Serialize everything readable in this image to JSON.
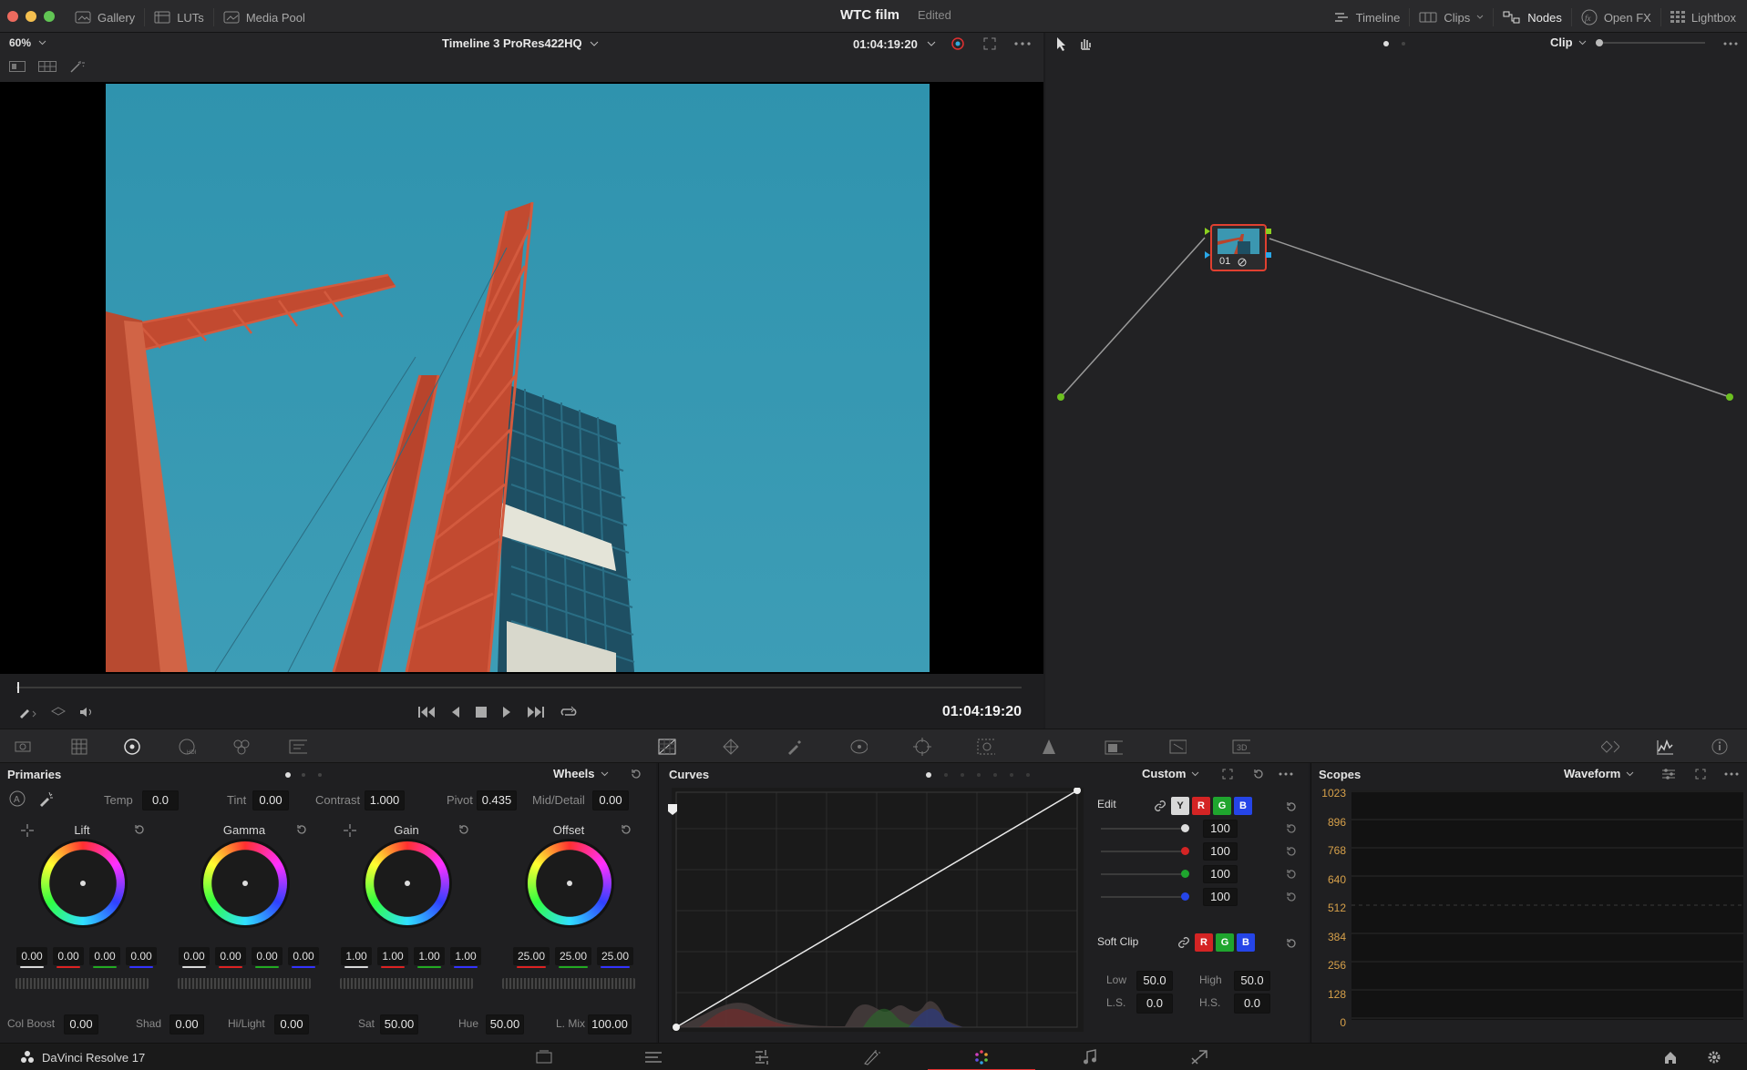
{
  "titlebar": {
    "title": "WTC film",
    "status": "Edited",
    "left": [
      {
        "label": "Gallery",
        "icon": "gallery-icon"
      },
      {
        "label": "LUTs",
        "icon": "luts-icon"
      },
      {
        "label": "Media Pool",
        "icon": "media-pool-icon"
      }
    ],
    "right": [
      {
        "label": "Timeline",
        "icon": "timeline-icon"
      },
      {
        "label": "Clips",
        "icon": "clips-icon"
      },
      {
        "label": "Nodes",
        "icon": "nodes-icon"
      },
      {
        "label": "Open FX",
        "icon": "fx-icon"
      },
      {
        "label": "Lightbox",
        "icon": "lightbox-icon"
      }
    ]
  },
  "viewer": {
    "zoom": "60%",
    "timeline_name": "Timeline 3 ProRes422HQ",
    "timecode": "01:04:19:20",
    "playhead_timecode": "01:04:19:20"
  },
  "nodes": {
    "mode": "Clip",
    "node_label": "01"
  },
  "primaries": {
    "title": "Primaries",
    "mode": "Wheels",
    "temp_label": "Temp",
    "temp": "0.0",
    "tint_label": "Tint",
    "tint": "0.00",
    "contrast_label": "Contrast",
    "contrast": "1.000",
    "pivot_label": "Pivot",
    "pivot": "0.435",
    "middetail_label": "Mid/Detail",
    "middetail": "0.00",
    "wheels": [
      {
        "name": "Lift",
        "values": [
          "0.00",
          "0.00",
          "0.00",
          "0.00"
        ]
      },
      {
        "name": "Gamma",
        "values": [
          "0.00",
          "0.00",
          "0.00",
          "0.00"
        ]
      },
      {
        "name": "Gain",
        "values": [
          "1.00",
          "1.00",
          "1.00",
          "1.00"
        ]
      },
      {
        "name": "Offset",
        "values": [
          "25.00",
          "25.00",
          "25.00"
        ]
      }
    ],
    "colboost_label": "Col Boost",
    "colboost": "0.00",
    "shad_label": "Shad",
    "shad": "0.00",
    "hilight_label": "Hi/Light",
    "hilight": "0.00",
    "sat_label": "Sat",
    "sat": "50.00",
    "hue_label": "Hue",
    "hue": "50.00",
    "lmix_label": "L. Mix",
    "lmix": "100.00"
  },
  "curves": {
    "title": "Curves",
    "mode": "Custom"
  },
  "curve_edit": {
    "edit_label": "Edit",
    "channels": [
      "Y",
      "R",
      "G",
      "B"
    ],
    "values": [
      "100",
      "100",
      "100",
      "100"
    ],
    "softclip_label": "Soft Clip",
    "low_label": "Low",
    "low": "50.0",
    "high_label": "High",
    "high": "50.0",
    "ls_label": "L.S.",
    "ls": "0.0",
    "hs_label": "H.S.",
    "hs": "0.0"
  },
  "scopes": {
    "title": "Scopes",
    "mode": "Waveform",
    "ticks": [
      "1023",
      "896",
      "768",
      "640",
      "512",
      "384",
      "256",
      "128",
      "0"
    ]
  },
  "app": {
    "name": "DaVinci Resolve 17"
  },
  "colors": {
    "accent": "#e03030",
    "node_border": "#e04030",
    "waveform_ticks": "#d6a04a",
    "sky": "#3a9bb5"
  }
}
